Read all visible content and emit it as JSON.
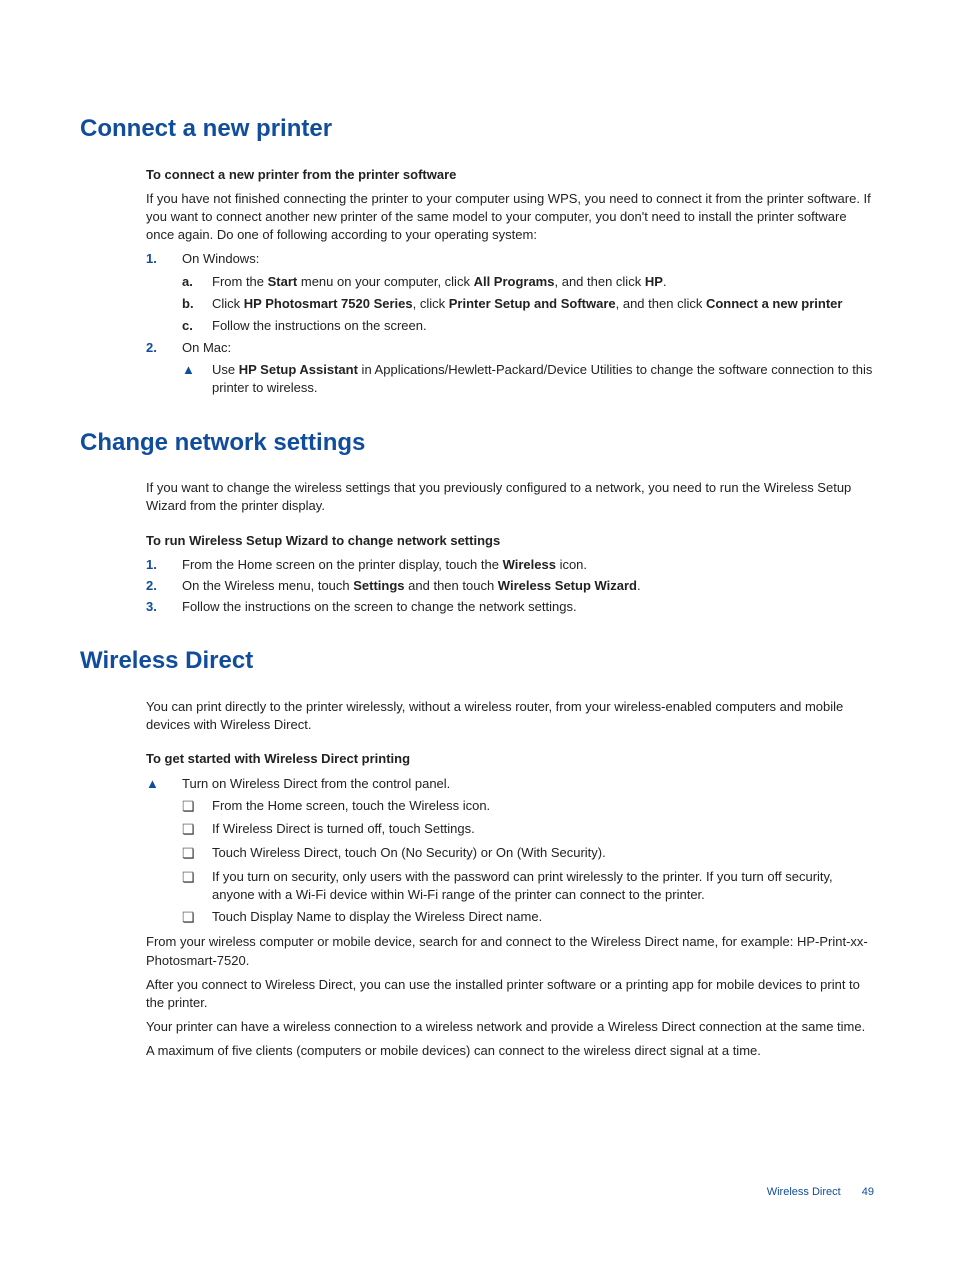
{
  "section1": {
    "title": "Connect a new printer",
    "subhead": "To connect a new printer from the printer software",
    "intro": "If you have not finished connecting the printer to your computer using WPS, you need to connect it from the printer software. If you want to connect another new printer of the same model to your computer, you don't need to install the printer software once again. Do one of following according to your operating system:",
    "step1_label": "On Windows:",
    "a_pre": "From the ",
    "a_b1": "Start",
    "a_mid": " menu on your computer, click ",
    "a_b2": "All Programs",
    "a_mid2": ", and then click ",
    "a_b3": "HP",
    "a_end": ".",
    "b_pre": "Click ",
    "b_b1": "HP Photosmart 7520 Series",
    "b_mid": ", click ",
    "b_b2": "Printer Setup and Software",
    "b_mid2": ", and then click ",
    "b_b3": "Connect a new printer",
    "c_text": "Follow the instructions on the screen.",
    "step2_label": "On Mac:",
    "mac_pre": "Use ",
    "mac_b1": "HP Setup Assistant",
    "mac_post": " in Applications/Hewlett-Packard/Device Utilities to change the software connection to this printer to wireless."
  },
  "section2": {
    "title": "Change network settings",
    "intro": "If you want to change the wireless settings that you previously configured to a network, you need to run the Wireless Setup Wizard from the printer display.",
    "subhead": "To run Wireless Setup Wizard to change network settings",
    "s1_pre": "From the Home screen on the printer display, touch the ",
    "s1_b": "Wireless",
    "s1_post": " icon.",
    "s2_pre": "On the Wireless menu, touch ",
    "s2_b1": "Settings",
    "s2_mid": " and then touch ",
    "s2_b2": "Wireless Setup Wizard",
    "s2_end": ".",
    "s3": "Follow the instructions on the screen to change the network settings."
  },
  "section3": {
    "title": "Wireless Direct",
    "intro": "You can print directly to the printer wirelessly, without a wireless router, from your wireless-enabled computers and mobile devices with Wireless Direct.",
    "subhead": "To get started with Wireless Direct printing",
    "tri1": "Turn on Wireless Direct from the control panel.",
    "sq1": "From the Home screen, touch the Wireless icon.",
    "sq2": "If Wireless Direct is turned off, touch Settings.",
    "sq3": "Touch Wireless Direct, touch On (No Security) or On (With Security).",
    "sq4": "If you turn on security, only users with the password can print wirelessly to the printer. If you turn off security, anyone with a Wi-Fi device within Wi-Fi range of the printer can connect to the printer.",
    "sq5": "Touch Display Name to display the Wireless Direct name.",
    "p1": "From your wireless computer or mobile device, search for and connect to the Wireless Direct name, for example: HP-Print-xx-Photosmart-7520.",
    "p2": "After you connect to Wireless Direct, you can use the installed printer software or a printing app for mobile devices to print to the printer.",
    "p3": "Your printer can have a wireless connection to a wireless network and provide a Wireless Direct connection at the same time.",
    "p4": "A maximum of five clients (computers or mobile devices) can connect to the wireless direct signal at a time."
  },
  "footer": {
    "label": "Wireless Direct",
    "page": "49"
  },
  "markers": {
    "n1": "1.",
    "n2": "2.",
    "n3": "3.",
    "a": "a.",
    "b": "b.",
    "c": "c.",
    "tri": "▲",
    "sq": "❏"
  }
}
